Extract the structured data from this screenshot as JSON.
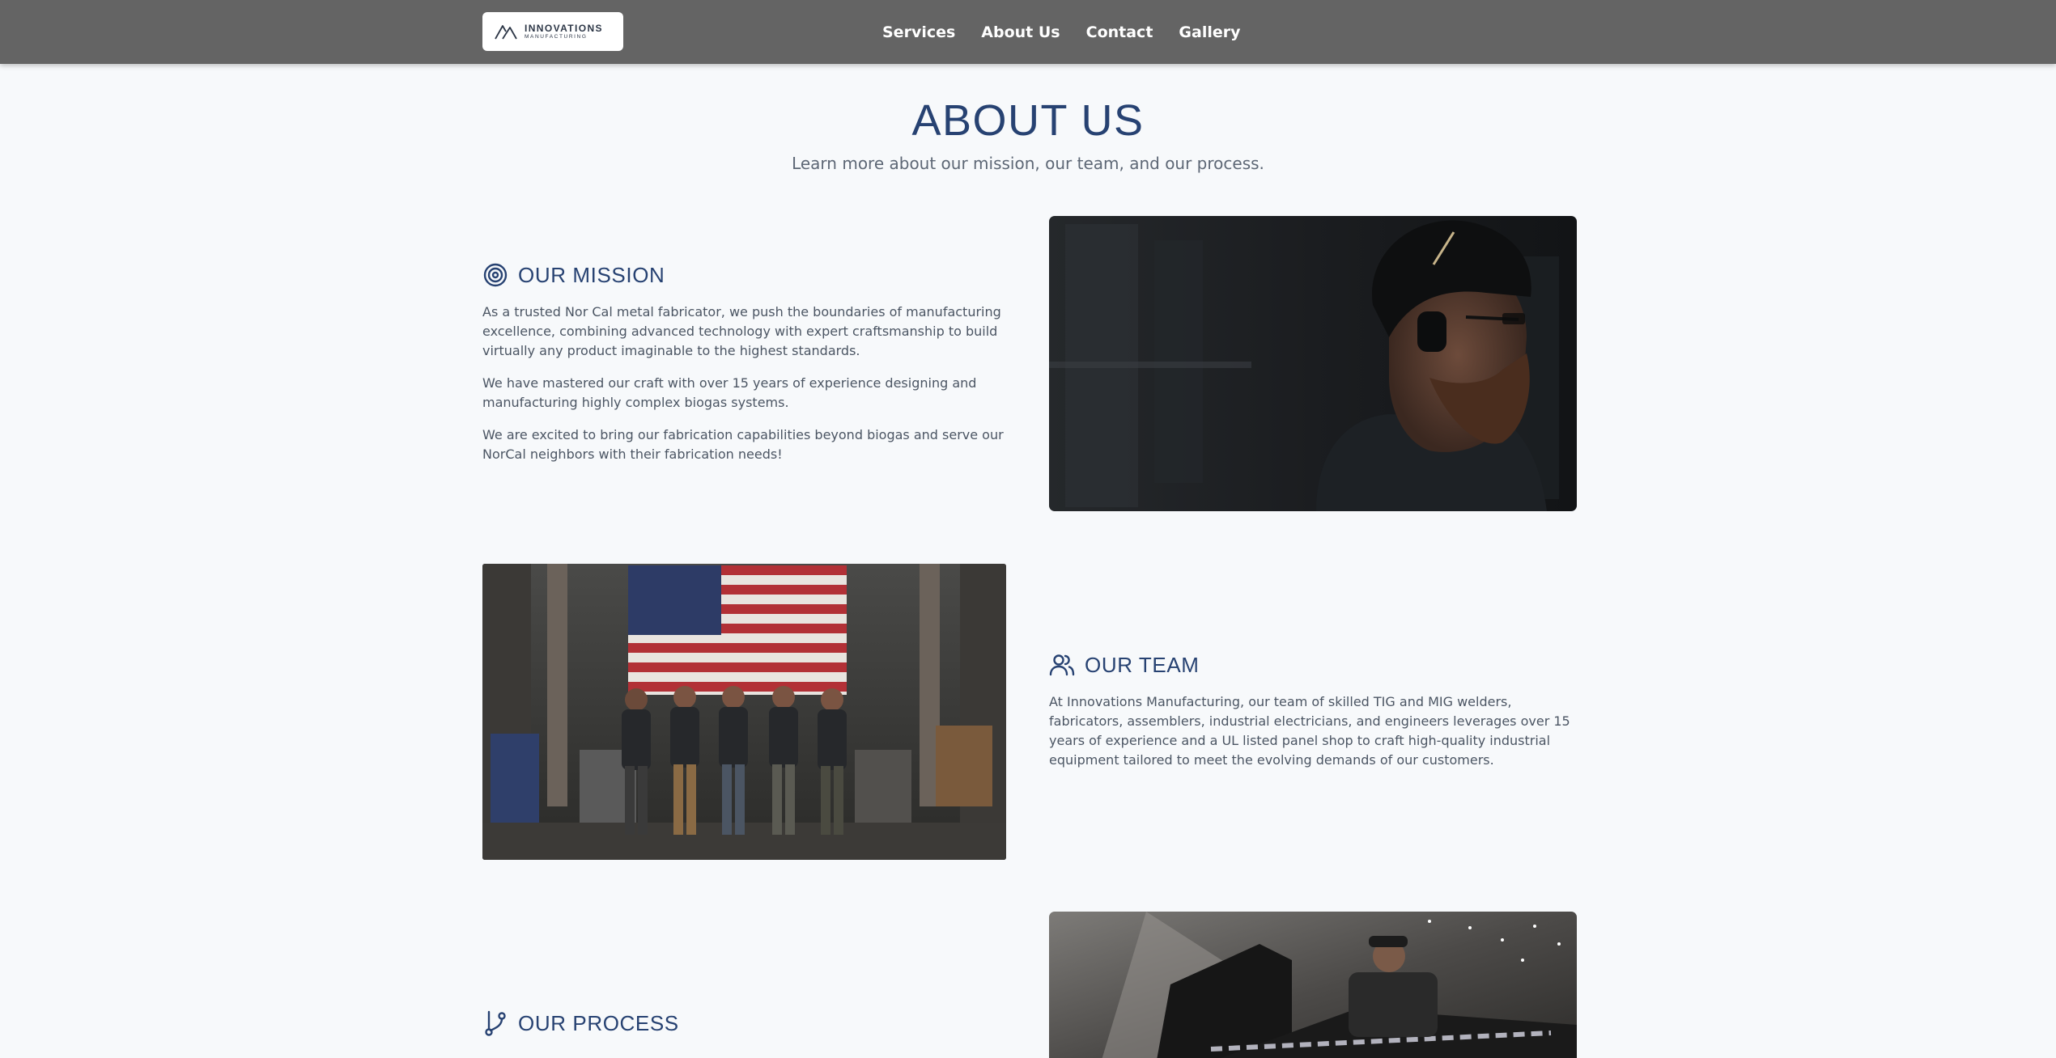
{
  "brand": {
    "name": "INNOVATIONS",
    "sub": "MANUFACTURING"
  },
  "nav": {
    "services": "Services",
    "about": "About Us",
    "contact": "Contact",
    "gallery": "Gallery"
  },
  "page": {
    "title": "ABOUT US",
    "subtitle": "Learn more about our mission, our team, and our process."
  },
  "mission": {
    "icon": "target-icon",
    "title": "OUR MISSION",
    "p1": "As a trusted Nor Cal metal fabricator, we push the boundaries of manufacturing excellence, combining advanced technology with expert craftsmanship to build virtually any product imaginable to the highest standards.",
    "p2": "We have mastered our craft with over 15 years of experience designing and manufacturing highly complex biogas systems.",
    "p3": "We are excited to bring our fabrication capabilities beyond biogas and serve our NorCal neighbors with their fabrication needs!"
  },
  "team": {
    "icon": "users-icon",
    "title": "OUR TEAM",
    "p1": "At Innovations Manufacturing, our team of skilled TIG and MIG welders, fabricators, assemblers, industrial electricians, and engineers leverages over 15 years of experience and a UL listed panel shop to craft high-quality industrial equipment tailored to meet the evolving demands of our customers."
  },
  "process": {
    "icon": "git-branch-icon",
    "title": "OUR PROCESS"
  },
  "colors": {
    "header": "#646464",
    "accent": "#274272",
    "background": "#f7f9fb"
  }
}
